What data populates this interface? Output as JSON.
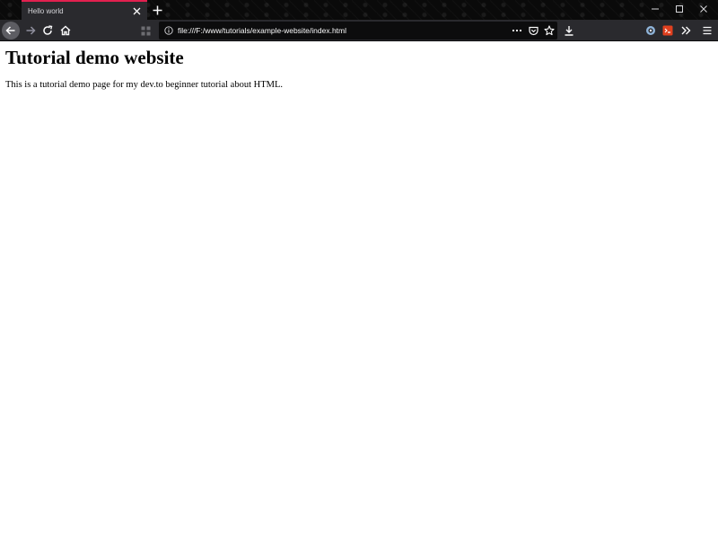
{
  "browser": {
    "tab": {
      "title": "Hello world"
    },
    "url": "file:///F:/www/tutorials/example-website/index.html",
    "colors": {
      "tab_accent": "#e2204f",
      "toolbar": "#2a2a2e",
      "urlbar": "#0c0c0d",
      "titlebar": "#0a0a0a"
    },
    "icons": {
      "back": "arrow-left-icon",
      "forward": "arrow-right-icon",
      "reload": "reload-icon",
      "home": "home-icon",
      "page_grid": "grid-icon",
      "site_info": "info-icon",
      "page_actions": "more-horizontal-icon",
      "pocket": "pocket-icon",
      "bookmark": "star-icon",
      "downloads": "download-icon",
      "extension_1": "extension-icon",
      "extension_2": "extension-icon",
      "overflow": "chevrons-right-icon",
      "menu": "hamburger-menu-icon"
    }
  },
  "page": {
    "heading": "Tutorial demo website",
    "paragraph": "This is a tutorial demo page for my dev.to beginner tutorial about HTML."
  }
}
